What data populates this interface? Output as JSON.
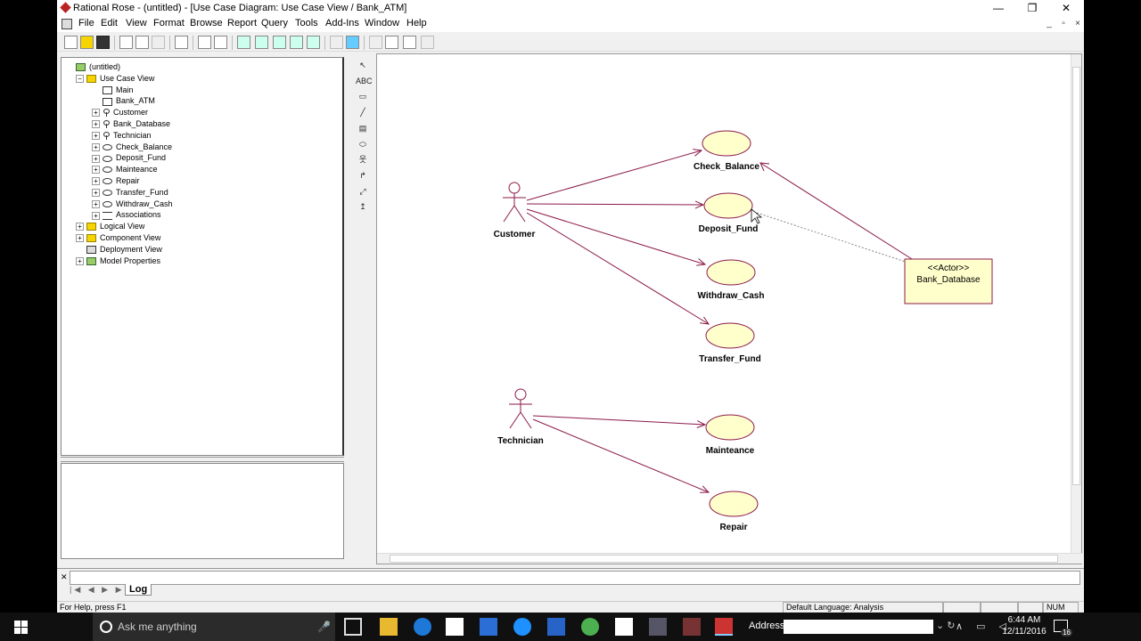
{
  "window": {
    "title": "Rational Rose - (untitled) - [Use Case Diagram: Use Case View / Bank_ATM]",
    "min": "—",
    "restore": "❐",
    "close": "✕"
  },
  "menu": [
    "File",
    "Edit",
    "View",
    "Format",
    "Browse",
    "Report",
    "Query",
    "Tools",
    "Add-Ins",
    "Window",
    "Help"
  ],
  "tree": [
    {
      "label": "(untitled)",
      "icon": "model-icon",
      "depth": 0,
      "exp": ""
    },
    {
      "label": "Use Case View",
      "icon": "folder-icon",
      "depth": 1,
      "exp": "−"
    },
    {
      "label": "Main",
      "icon": "diagram-icon",
      "depth": 2,
      "exp": ""
    },
    {
      "label": "Bank_ATM",
      "icon": "diagram-icon",
      "depth": 2,
      "exp": ""
    },
    {
      "label": "Customer",
      "icon": "actor-icon",
      "depth": 2,
      "exp": "+"
    },
    {
      "label": "Bank_Database",
      "icon": "actor-icon",
      "depth": 2,
      "exp": "+"
    },
    {
      "label": "Technician",
      "icon": "actor-icon",
      "depth": 2,
      "exp": "+"
    },
    {
      "label": "Check_Balance",
      "icon": "usecase-icon",
      "depth": 2,
      "exp": "+"
    },
    {
      "label": "Deposit_Fund",
      "icon": "usecase-icon",
      "depth": 2,
      "exp": "+"
    },
    {
      "label": "Mainteance",
      "icon": "usecase-icon",
      "depth": 2,
      "exp": "+"
    },
    {
      "label": "Repair",
      "icon": "usecase-icon",
      "depth": 2,
      "exp": "+"
    },
    {
      "label": "Transfer_Fund",
      "icon": "usecase-icon",
      "depth": 2,
      "exp": "+"
    },
    {
      "label": "Withdraw_Cash",
      "icon": "usecase-icon",
      "depth": 2,
      "exp": "+"
    },
    {
      "label": "Associations",
      "icon": "associations-icon",
      "depth": 2,
      "exp": "+"
    },
    {
      "label": "Logical View",
      "icon": "folder-icon",
      "depth": 1,
      "exp": "+"
    },
    {
      "label": "Component View",
      "icon": "folder-icon",
      "depth": 1,
      "exp": "+"
    },
    {
      "label": "Deployment View",
      "icon": "deployment-icon",
      "depth": 1,
      "exp": ""
    },
    {
      "label": "Model Properties",
      "icon": "properties-icon",
      "depth": 1,
      "exp": "+"
    }
  ],
  "toolbox": [
    {
      "name": "selection-tool",
      "glyph": "↖"
    },
    {
      "name": "text-tool",
      "glyph": "ABC"
    },
    {
      "name": "note-tool",
      "glyph": "▭"
    },
    {
      "name": "anchor-tool",
      "glyph": "╱"
    },
    {
      "name": "package-tool",
      "glyph": "▤"
    },
    {
      "name": "use-case-tool",
      "glyph": "⬭"
    },
    {
      "name": "actor-tool",
      "glyph": "웃"
    },
    {
      "name": "association-tool",
      "glyph": "↱"
    },
    {
      "name": "dependency-tool",
      "glyph": "⤢"
    },
    {
      "name": "generalization-tool",
      "glyph": "↥"
    }
  ],
  "diagram": {
    "actors": [
      {
        "id": "customer",
        "label": "Customer"
      },
      {
        "id": "technician",
        "label": "Technician"
      }
    ],
    "usecases": [
      {
        "id": "check_balance",
        "label": "Check_Balance"
      },
      {
        "id": "deposit_fund",
        "label": "Deposit_Fund"
      },
      {
        "id": "withdraw_cash",
        "label": "Withdraw_Cash"
      },
      {
        "id": "transfer_fund",
        "label": "Transfer_Fund"
      },
      {
        "id": "mainteance",
        "label": "Mainteance"
      },
      {
        "id": "repair",
        "label": "Repair"
      }
    ],
    "bank_actor": {
      "stereotype": "<<Actor>>",
      "label": "Bank_Database"
    },
    "colors": {
      "association": "#8b1a4a",
      "usecase_fill": "#ffffcc",
      "usecase_stroke": "#8b1a4a",
      "actor_box": "#ffffcc"
    }
  },
  "log": {
    "tab_label": "Log",
    "close": "✕",
    "navs": "|◀ ◀ ▶ ▶|"
  },
  "status": {
    "help": "For Help, press F1",
    "language": "Default Language: Analysis",
    "num": "NUM"
  },
  "taskbar": {
    "search_placeholder": "Ask me anything",
    "mic": "🎤",
    "address_label": "Address",
    "go": "⌄ ↻",
    "tray": "∧ ▭ ◁",
    "time": "6:44 AM",
    "date": "12/11/2016",
    "notifications": "16"
  }
}
